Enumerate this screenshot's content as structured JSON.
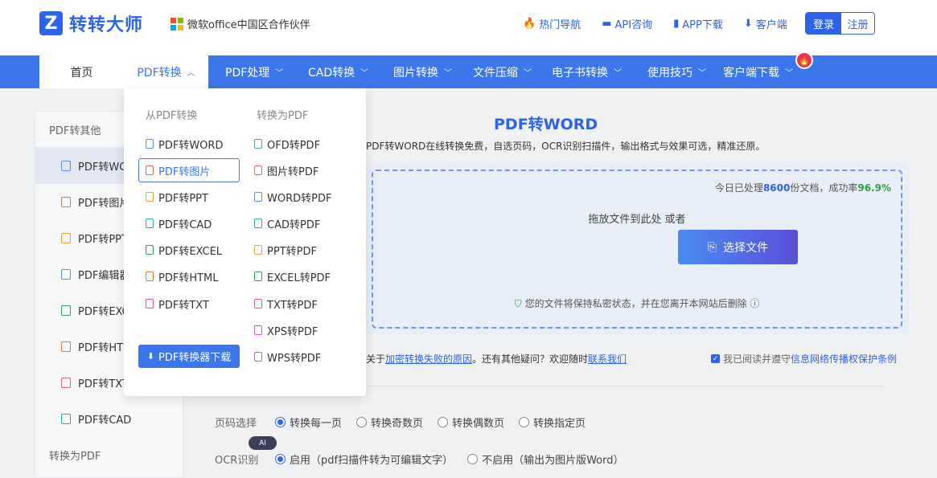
{
  "brand": {
    "name": "转转大师",
    "partner": "微软office中国区合作伙伴"
  },
  "toplinks": [
    {
      "icon": "fire-icon",
      "label": "热门导航"
    },
    {
      "icon": "chat-icon",
      "label": "API咨询"
    },
    {
      "icon": "phone-icon",
      "label": "APP下载"
    },
    {
      "icon": "download-icon",
      "label": "客户端"
    }
  ],
  "auth": {
    "login": "登录",
    "register": "注册"
  },
  "nav": {
    "home": "首页",
    "active": "PDF转换",
    "items": [
      "PDF处理",
      "CAD转换",
      "图片转换",
      "文件压缩",
      "电子书转换",
      "使用技巧",
      "客户端下载"
    ]
  },
  "sidebar": {
    "head": "PDF转其他",
    "items": [
      "PDF转WORD",
      "PDF转图片",
      "PDF转PPT",
      "PDF编辑器",
      "PDF转EXCEL",
      "PDF转HTML",
      "PDF转TXT",
      "PDF转CAD"
    ],
    "sub": "转换为PDF"
  },
  "main": {
    "title": "PDF转WORD",
    "desc": "PDF转WORD在线转换免费，自选页码，OCR识别扫描件，输出格式与效果可选，精准还原。",
    "stat_prefix": "今日已处理",
    "stat_count": "8600",
    "stat_mid": "份文档，成功率",
    "stat_rate": "96.9%",
    "drop_text": "拖放文件到此处 或者",
    "choose_btn": "选择文件",
    "privacy": "您的文件将保持私密状态，并在您离开本网站后删除",
    "note_prefix": "关于",
    "note_link1": "加密转换失败的原因",
    "note_mid": "。还有其他疑问？欢迎随时",
    "note_link2": "联系我们",
    "agree_prefix": "我已阅读并遵守",
    "agree_link": "信息网络传播权保护条例",
    "page_label": "页码选择",
    "page_opts": [
      "转换每一页",
      "转换奇数页",
      "转换偶数页",
      "转换指定页"
    ],
    "ocr_label": "OCR识别",
    "ocr_opts": [
      "启用（pdf扫描件转为可编辑文字）",
      "不启用（输出为图片版Word）"
    ]
  },
  "dropdown": {
    "from_head": "从PDF转换",
    "to_head": "转换为PDF",
    "from_items": [
      "PDF转WORD",
      "PDF转图片",
      "PDF转PPT",
      "PDF转CAD",
      "PDF转EXCEL",
      "PDF转HTML",
      "PDF转TXT"
    ],
    "to_items": [
      "OFD转PDF",
      "图片转PDF",
      "WORD转PDF",
      "CAD转PDF",
      "PPT转PDF",
      "EXCEL转PDF",
      "TXT转PDF",
      "XPS转PDF",
      "WPS转PDF"
    ],
    "download_btn": "PDF转换器下载"
  },
  "colors": {
    "accent": "#3b76ea",
    "brand": "#2d63e8",
    "success": "#2aa33b",
    "hot": "#e8344e"
  }
}
